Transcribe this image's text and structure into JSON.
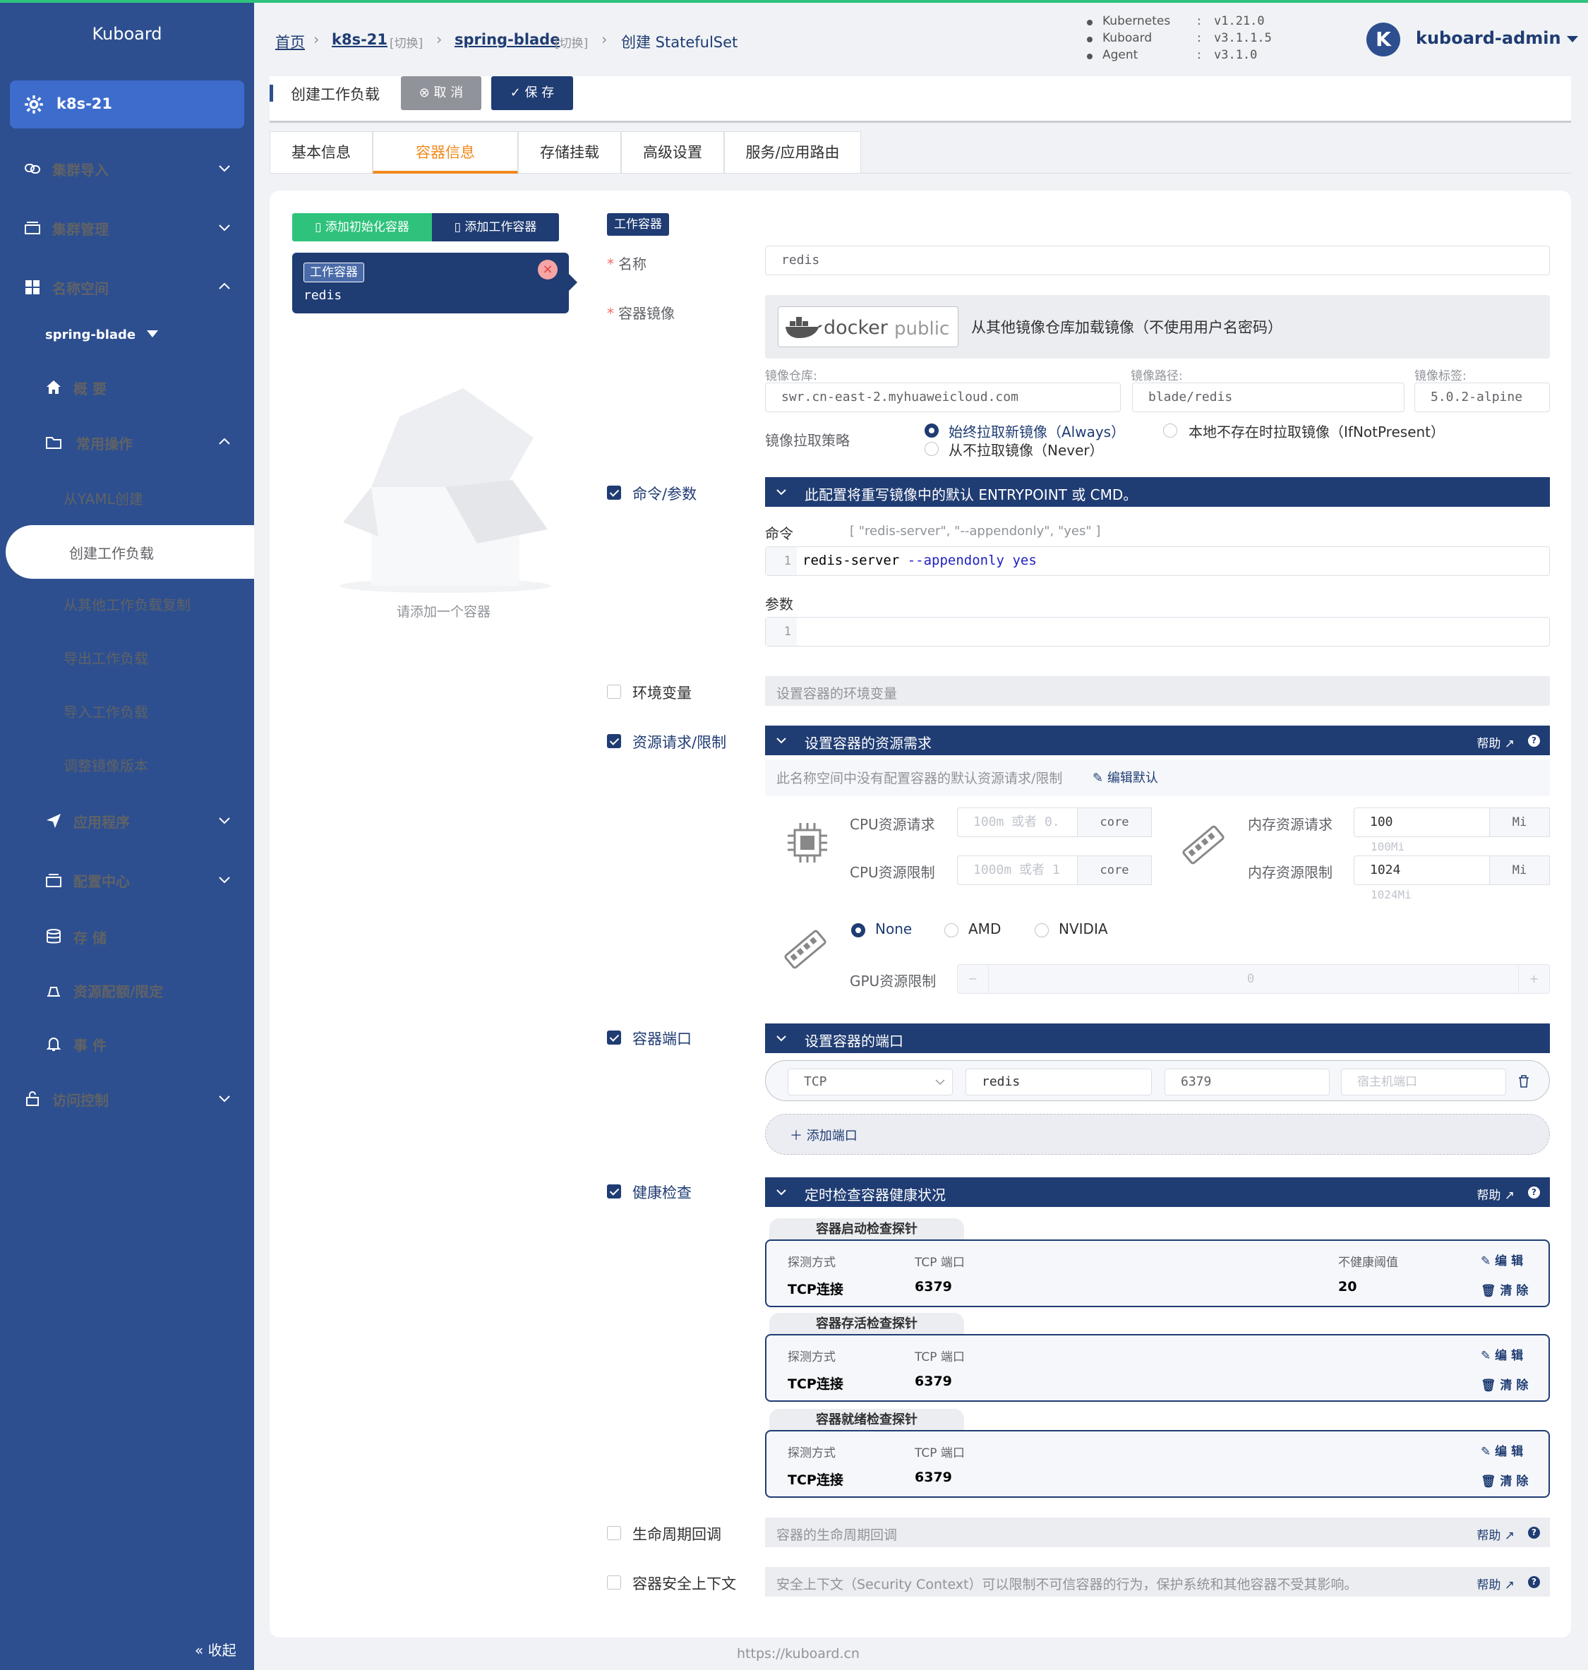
{
  "app": {
    "title": "Kuboard",
    "cluster": "k8s-21",
    "collapse": "收起",
    "footer": "https://kuboard.cn"
  },
  "sidebar": {
    "items": [
      {
        "label": "集群导入"
      },
      {
        "label": "集群管理"
      },
      {
        "label": "名称空间"
      }
    ],
    "namespace": "spring-blade",
    "ns_items": [
      {
        "label": "概 要"
      },
      {
        "label": "常用操作"
      }
    ],
    "sub": [
      "从YAML创建",
      "创建工作负载",
      "从其他工作负载复制",
      "导出工作负载",
      "导入工作负载",
      "调整镜像版本"
    ],
    "more": [
      {
        "label": "应用程序"
      },
      {
        "label": "配置中心"
      },
      {
        "label": "存 储"
      },
      {
        "label": "资源配额/限定"
      },
      {
        "label": "事 件"
      },
      {
        "label": "访问控制"
      }
    ]
  },
  "breadcrumb": {
    "home": "首页",
    "cluster": "k8s-21",
    "switch": "[切换]",
    "ns": "spring-blade",
    "current": "创建 StatefulSet"
  },
  "versions": [
    {
      "k": "Kubernetes",
      "c": ":",
      "v": "v1.21.0"
    },
    {
      "k": "Kuboard",
      "c": ":",
      "v": "v3.1.1.5"
    },
    {
      "k": "Agent",
      "c": ":",
      "v": "v3.1.0"
    }
  ],
  "user": {
    "initial": "K",
    "name": "kuboard-admin"
  },
  "toolbar": {
    "title": "创建工作负载",
    "cancel": "取 消",
    "save": "保 存"
  },
  "tabs": [
    "基本信息",
    "容器信息",
    "存储挂载",
    "高级设置",
    "服务/应用路由"
  ],
  "containers": {
    "add_init": "添加初始化容器",
    "add_work": "添加工作容器",
    "card_tag": "工作容器",
    "card_name": "redis",
    "empty": "请添加一个容器"
  },
  "form": {
    "section_tag": "工作容器",
    "name_label": "名称",
    "name": "redis",
    "image_label": "容器镜像",
    "image_source": "从其他镜像仓库加载镜像（不使用用户名密码）",
    "docker_logo": "docker",
    "docker_public": "public",
    "repo_label": "镜像仓库:",
    "repo": "swr.cn-east-2.myhuaweicloud.com",
    "path_label": "镜像路径:",
    "path": "blade/redis",
    "tag_label": "镜像标签:",
    "tag": "5.0.2-alpine",
    "pull_label": "镜像拉取策略",
    "pull_always": "始终拉取新镜像（Always）",
    "pull_ifnot": "本地不存在时拉取镜像（IfNotPresent）",
    "pull_never": "从不拉取镜像（Never）",
    "cmd_check": "命令/参数",
    "cmd_bar": "此配置将重写镜像中的默认 ENTRYPOINT 或 CMD。",
    "cmd_label": "命令",
    "cmd_hint": "[ \"redis-server\", \"--appendonly\", \"yes\" ]",
    "cmd_line": "1",
    "cmd_a": "redis-server ",
    "cmd_b": "--appendonly",
    "cmd_c": " yes",
    "args_label": "参数",
    "args_line": "1",
    "env_check": "环境变量",
    "env_bar": "设置容器的环境变量",
    "res_check": "资源请求/限制",
    "res_bar": "设置容器的资源需求",
    "help": "帮助",
    "res_note": "此名称空间中没有配置容器的默认资源请求/限制",
    "res_edit": "编辑默认",
    "cpu_req": "CPU资源请求",
    "cpu_req_ph": "100m 或者 0.",
    "cpu_unit": "core",
    "cpu_lim": "CPU资源限制",
    "cpu_lim_ph": "1000m 或者 1",
    "mem_req": "内存资源请求",
    "mem_req_v": "100",
    "mem_unit": "Mi",
    "mem_req_hint": "100Mi",
    "mem_lim": "内存资源限制",
    "mem_lim_v": "1024",
    "mem_lim_hint": "1024Mi",
    "gpu_none": "None",
    "gpu_amd": "AMD",
    "gpu_nvidia": "NVIDIA",
    "gpu_lim": "GPU资源限制",
    "gpu_val": "0",
    "gpu_minus": "−",
    "gpu_plus": "+",
    "port_check": "容器端口",
    "port_bar": "设置容器的端口",
    "port_proto": "TCP",
    "port_name": "redis",
    "port_num": "6379",
    "port_host_ph": "宿主机端口",
    "add_port": "添加端口",
    "health_check": "健康检查",
    "health_bar": "定时检查容器健康状况",
    "probes": [
      {
        "title": "容器启动检查探针",
        "h1": "探测方式",
        "h2": "TCP 端口",
        "h3": "不健康阈值",
        "v1": "TCP连接",
        "v2": "6379",
        "v3": "20"
      },
      {
        "title": "容器存活检查探针",
        "h1": "探测方式",
        "h2": "TCP 端口",
        "v1": "TCP连接",
        "v2": "6379"
      },
      {
        "title": "容器就绪检查探针",
        "h1": "探测方式",
        "h2": "TCP 端口",
        "v1": "TCP连接",
        "v2": "6379"
      }
    ],
    "edit": "编 辑",
    "clear": "清 除",
    "life_check": "生命周期回调",
    "life_bar": "容器的生命周期回调",
    "sec_check": "容器安全上下文",
    "sec_bar": "安全上下文（Security Context）可以限制不可信容器的行为，保护系统和其他容器不受其影响。"
  },
  "colors": {
    "primary": "#1f3c73",
    "sidebar": "#2d4f8f",
    "accent": "#2fc27c",
    "tab_active": "#f08a1c"
  }
}
